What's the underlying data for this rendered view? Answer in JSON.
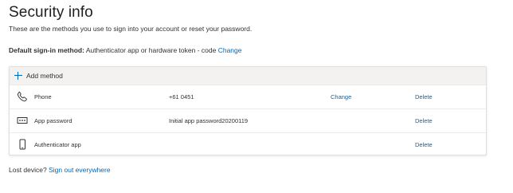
{
  "page": {
    "title": "Security info",
    "subtitle": "These are the methods you use to sign into your account or reset your password."
  },
  "default_method": {
    "label": "Default sign-in method:",
    "value": "Authenticator app or hardware token - code",
    "change_label": "Change"
  },
  "methods": {
    "add_label": "Add method",
    "rows": [
      {
        "icon": "phone-icon",
        "name": "Phone",
        "value": "+61 0451",
        "change": "Change",
        "delete": "Delete"
      },
      {
        "icon": "app-password-icon",
        "name": "App password",
        "value": "Initial app password20200119",
        "change": "",
        "delete": "Delete"
      },
      {
        "icon": "authenticator-app-icon",
        "name": "Authenticator app",
        "value": "",
        "change": "",
        "delete": "Delete"
      }
    ]
  },
  "footer": {
    "lost_device_text": "Lost device?",
    "sign_out_link": "Sign out everywhere"
  },
  "colors": {
    "accent": "#0067b8",
    "text": "#323130",
    "add_bar_bg": "#f3f2f1",
    "border": "#e1dfdd"
  }
}
